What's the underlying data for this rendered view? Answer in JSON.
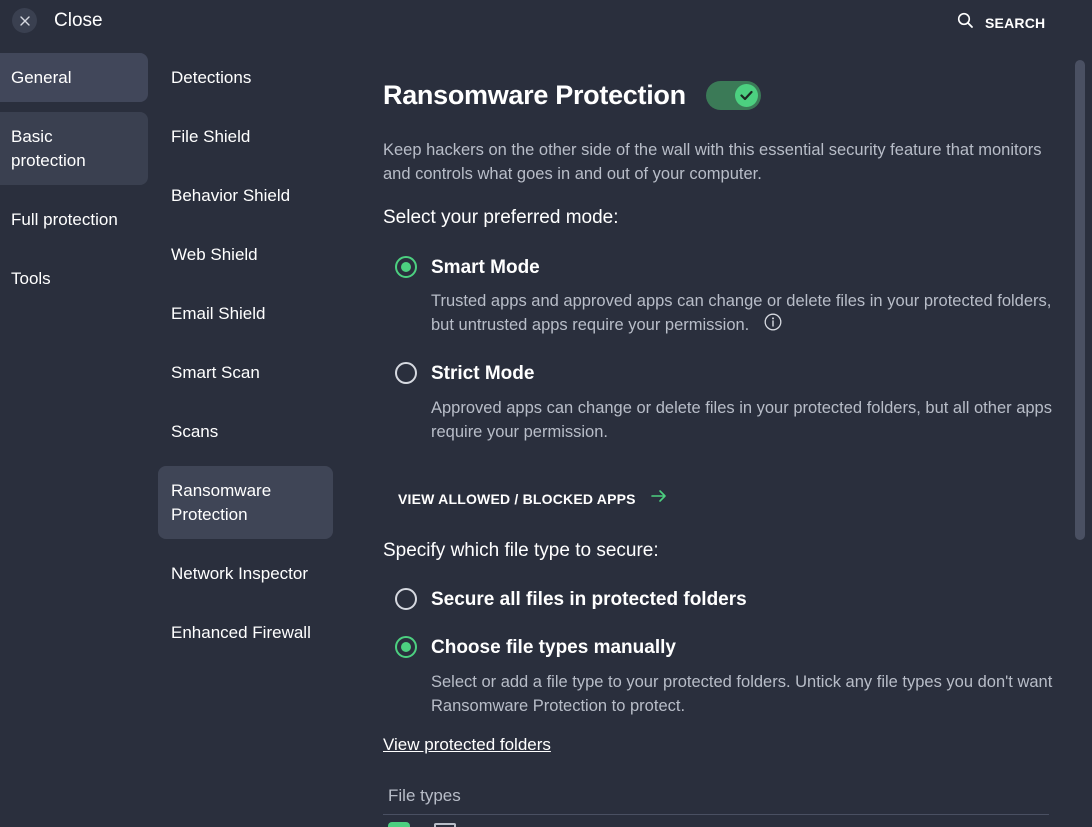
{
  "header": {
    "close_label": "Close",
    "search_label": "SEARCH"
  },
  "nav_primary": [
    {
      "label": "General"
    },
    {
      "label": "Basic protection"
    },
    {
      "label": "Full protection"
    },
    {
      "label": "Tools"
    }
  ],
  "nav_secondary": [
    {
      "label": "Detections"
    },
    {
      "label": "File Shield"
    },
    {
      "label": "Behavior Shield"
    },
    {
      "label": "Web Shield"
    },
    {
      "label": "Email Shield"
    },
    {
      "label": "Smart Scan"
    },
    {
      "label": "Scans"
    },
    {
      "label": "Ransomware Protection"
    },
    {
      "label": "Network Inspector"
    },
    {
      "label": "Enhanced Firewall"
    }
  ],
  "main": {
    "title": "Ransomware Protection",
    "toggle_on": true,
    "description": "Keep hackers on the other side of the wall with this essential security feature that monitors and controls what goes in and out of your computer.",
    "mode_heading": "Select your preferred mode:",
    "modes": [
      {
        "label": "Smart Mode",
        "selected": true,
        "description": "Trusted apps and approved apps can change or delete files in your protected folders, but untrusted apps require your permission."
      },
      {
        "label": "Strict Mode",
        "selected": false,
        "description": "Approved apps can change or delete files in your protected folders, but all other apps require your permission."
      }
    ],
    "allowed_link": "VIEW ALLOWED / BLOCKED APPS",
    "filetype_heading": "Specify which file type to secure:",
    "filetype_options": [
      {
        "label": "Secure all files in protected folders",
        "selected": false
      },
      {
        "label": "Choose file types manually",
        "selected": true,
        "description": "Select or add a file type to your protected folders. Untick any file types you don't want Ransomware Protection to protect."
      }
    ],
    "folders_link": "View protected folders",
    "table_header": "File types"
  },
  "colors": {
    "background": "#2a2f3d",
    "accent_green": "#4cd080",
    "muted_text": "#b8bdc8"
  },
  "icons": {
    "close": "close-icon",
    "search": "search-icon",
    "check": "check-icon",
    "info": "info-icon",
    "arrow": "arrow-right-icon"
  }
}
